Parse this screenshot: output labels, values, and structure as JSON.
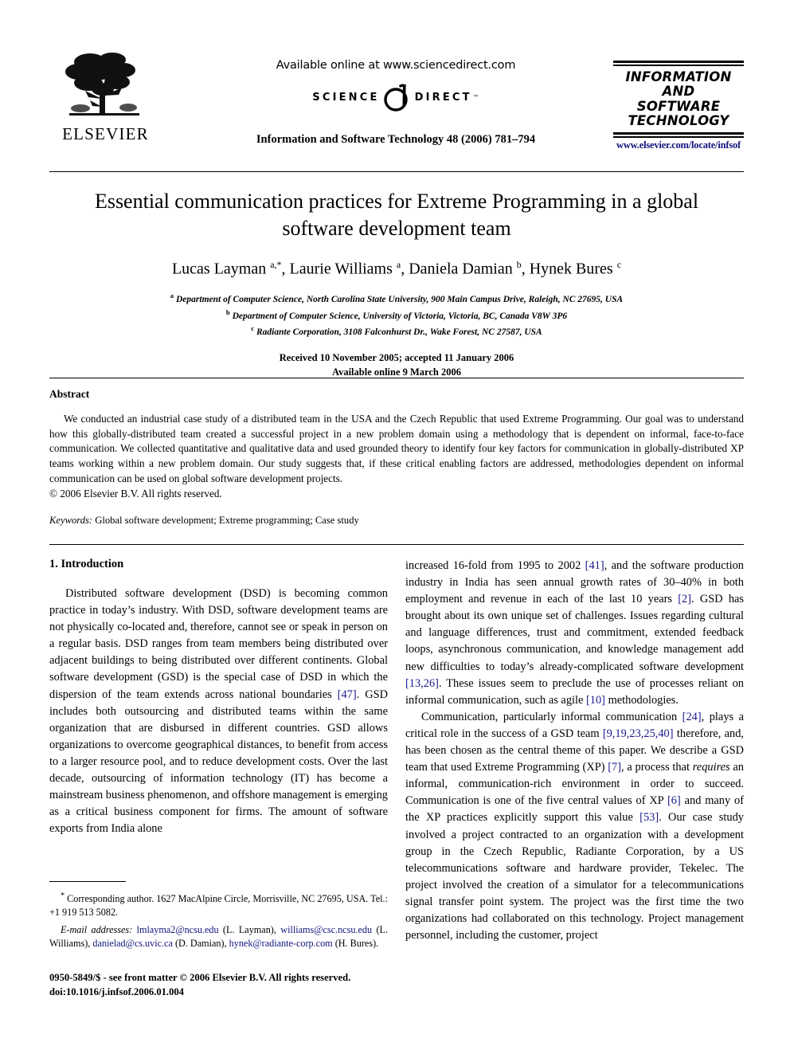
{
  "masthead": {
    "publisher_name": "ELSEVIER",
    "available_online": "Available online at www.sciencedirect.com",
    "sciencedirect_left": "SCIENCE",
    "sciencedirect_right": "DIRECT",
    "sciencedirect_tm": "™",
    "journal_reference": "Information and Software Technology 48 (2006) 781–794",
    "journal_logo_line1": "INFORMATION",
    "journal_logo_line2": "AND",
    "journal_logo_line3": "SOFTWARE",
    "journal_logo_line4": "TECHNOLOGY",
    "journal_url": "www.elsevier.com/locate/infsof",
    "journal_url_color": "#12137e"
  },
  "title_block": {
    "title": "Essential communication practices for Extreme Programming in a global software development team",
    "authors_html": "Lucas Layman <sup>a,*</sup>, Laurie Williams <sup>a</sup>, Daniela Damian <sup>b</sup>, Hynek Bures <sup>c</sup>",
    "authors_plain": "Lucas Layman a,*, Laurie Williams a, Daniela Damian b, Hynek Bures c",
    "affiliation_a": "Department of Computer Science, North Carolina State University, 900 Main Campus Drive, Raleigh, NC 27695, USA",
    "affiliation_b": "Department of Computer Science, University of Victoria, Victoria, BC, Canada V8W 3P6",
    "affiliation_c": "Radiante Corporation, 3108 Falconhurst Dr., Wake Forest, NC 27587, USA",
    "received": "Received 10 November 2005; accepted 11 January 2006",
    "available_online": "Available online 9 March 2006"
  },
  "abstract": {
    "heading": "Abstract",
    "body": "We conducted an industrial case study of a distributed team in the USA and the Czech Republic that used Extreme Programming. Our goal was to understand how this globally-distributed team created a successful project in a new problem domain using a methodology that is dependent on informal, face-to-face communication. We collected quantitative and qualitative data and used grounded theory to identify four key factors for communication in globally-distributed XP teams working within a new problem domain. Our study suggests that, if these critical enabling factors are addressed, methodologies dependent on informal communication can be used on global software development projects.",
    "copyright": "© 2006 Elsevier B.V. All rights reserved.",
    "keywords_label": "Keywords:",
    "keywords_value": " Global software development; Extreme programming; Case study"
  },
  "body": {
    "section_number_title": "1. Introduction",
    "left_col": {
      "para1_part1": "Distributed software development (DSD) is becoming common practice in today’s industry. With DSD, software development teams are not physically co-located and, therefore, cannot see or speak in person on a regular basis. DSD ranges from team members being distributed over adjacent buildings to being distributed over different continents. Global software development (GSD) is the special case of DSD in which the dispersion of the team extends across national boundaries ",
      "cite1": "[47]",
      "para1_part2": ". GSD includes both outsourcing and distributed teams within the same organization that are disbursed in different countries. GSD allows organizations to overcome geographical distances, to benefit from access to a larger resource pool, and to reduce development costs. Over the last decade, outsourcing of information technology (IT) has become a mainstream business phenomenon, and offshore management is emerging as a critical business component for firms. The amount of software exports from India alone"
    },
    "right_col": {
      "para1_cont_a": "increased 16-fold from 1995 to 2002 ",
      "cite_41": "[41]",
      "para1_cont_b": ", and the software production industry in India has seen annual growth rates of 30–40% in both employment and revenue in each of the last 10 years ",
      "cite_2": "[2]",
      "para1_cont_c": ". GSD has brought about its own unique set of challenges. Issues regarding cultural and language differences, trust and commitment, extended feedback loops, asynchronous communication, and knowledge management add new difficulties to today’s already-complicated software development ",
      "cite_13_26": "[13,26]",
      "para1_cont_d": ". These issues seem to preclude the use of processes reliant on informal communication, such as agile ",
      "cite_10": "[10]",
      "para1_cont_e": " methodologies.",
      "para2_a": "Communication, particularly informal communication ",
      "cite_24": "[24]",
      "para2_b": ", plays a critical role in the success of a GSD team ",
      "cite_9_40": "[9,19,23,25,40]",
      "para2_c": " therefore, and, has been chosen as the central theme of this paper. We describe a GSD team that used Extreme Programming (XP) ",
      "cite_7": "[7]",
      "para2_d": ", a process that ",
      "para2_italic": "requires",
      "para2_e": " an informal, communication-rich environment in order to succeed. Communication is one of the five central values of XP ",
      "cite_6": "[6]",
      "para2_f": " and many of the XP practices explicitly support this value ",
      "cite_53": "[53]",
      "para2_g": ". Our case study involved a project contracted to an organization with a development group in the Czech Republic, Radiante Corporation, by a US telecommunications software and hardware provider, Tekelec. The project involved the creation of a simulator for a telecommunications signal transfer point system. The project was the first time the two organizations had collaborated on this technology. Project management personnel, including the customer, project"
    }
  },
  "footnotes": {
    "corresponding_marker": "*",
    "corresponding": " Corresponding author. 1627 MacAlpine Circle, Morrisville, NC 27695, USA. Tel.: +1 919 513 5082.",
    "email_label": "E-mail addresses:",
    "email_1": "lmlayma2@ncsu.edu",
    "email_1_name": " (L. Layman), ",
    "email_2": "williams@csc.ncsu.edu",
    "email_2_name": " (L. Williams), ",
    "email_3": "danielad@cs.uvic.ca",
    "email_3_name": " (D. Damian), ",
    "email_4": "hynek@radiante-corp.com",
    "email_4_name": " (H. Bures).",
    "link_color": "#12137e"
  },
  "imprint": {
    "issn_line": "0950-5849/$ - see front matter © 2006 Elsevier B.V. All rights reserved.",
    "doi_line": "doi:10.1016/j.infsof.2006.01.004"
  }
}
